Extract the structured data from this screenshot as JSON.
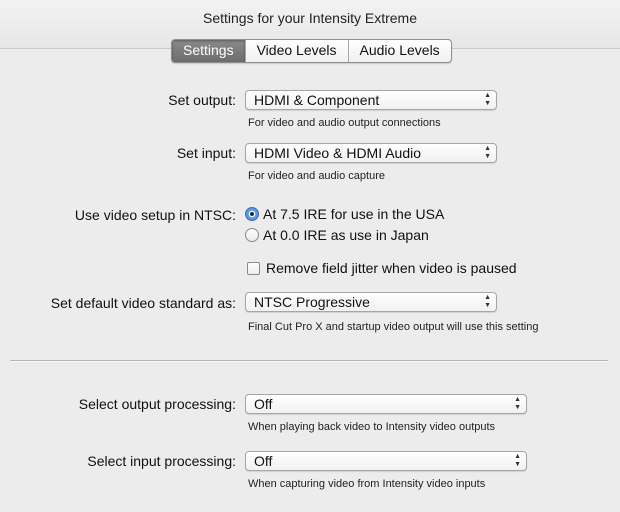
{
  "window": {
    "title": "Settings for your Intensity Extreme"
  },
  "tabs": [
    {
      "label": "Settings",
      "active": true
    },
    {
      "label": "Video Levels",
      "active": false
    },
    {
      "label": "Audio Levels",
      "active": false
    }
  ],
  "output": {
    "label": "Set output:",
    "value": "HDMI & Component",
    "hint": "For video and audio output connections"
  },
  "input": {
    "label": "Set input:",
    "value": "HDMI Video & HDMI Audio",
    "hint": "For video and audio capture"
  },
  "video_setup": {
    "label": "Use video setup in NTSC:",
    "options": [
      {
        "label": "At 7.5 IRE for use in the USA",
        "selected": true
      },
      {
        "label": "At 0.0 IRE as use in Japan",
        "selected": false
      }
    ]
  },
  "field_jitter": {
    "label": "Remove field jitter when video is paused",
    "checked": false
  },
  "video_standard": {
    "label": "Set default video standard as:",
    "value": "NTSC Progressive",
    "hint": "Final Cut Pro X and startup video output will use this setting"
  },
  "output_processing": {
    "label": "Select output processing:",
    "value": "Off",
    "hint": "When playing back video to Intensity video outputs"
  },
  "input_processing": {
    "label": "Select input processing:",
    "value": "Off",
    "hint": "When capturing video from Intensity video inputs"
  },
  "colors": {
    "background": "#ececec",
    "active_tab": "#7a7a7a",
    "radio_selected": "#3f7fd6"
  },
  "icons": {
    "select_arrows": "up-down-chevron-icon",
    "radio": "radio-button-icon",
    "checkbox": "checkbox-icon"
  }
}
